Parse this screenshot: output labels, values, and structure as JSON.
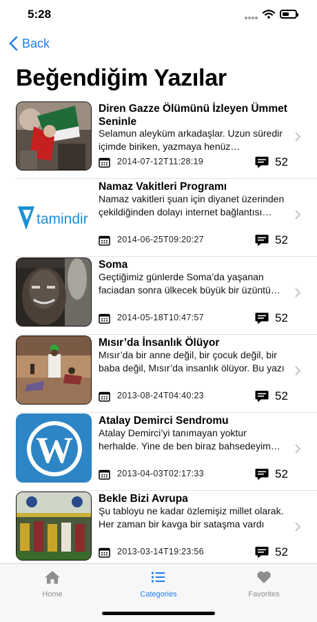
{
  "status": {
    "time": "5:28"
  },
  "nav": {
    "back_label": "Back",
    "title": "Beğendiğim Yazılar"
  },
  "items": [
    {
      "title": "Diren Gazze Ölümünü İzleyen Ümmet Seninle",
      "desc": "Selamun aleyküm arkadaşlar. Uzun süredir içimde biriken, yazmaya henüz başlayamadığım",
      "date": "2014-07-12T11:28:19",
      "count": "52"
    },
    {
      "title": "Namaz Vakitleri Programı",
      "desc": "Namaz vakitleri şuan için diyanet üzerinden çekildiğinden dolayı internet bağlantısı gerekli",
      "date": "2014-06-25T09:20:27",
      "count": "52",
      "logo_text": "tamindir"
    },
    {
      "title": "Soma",
      "desc": "Geçtiğimiz günlerde Soma’da yaşanan faciadan sonra ülkecek büyük bir üzüntü yaşadık",
      "date": "2014-05-18T10:47:57",
      "count": "52"
    },
    {
      "title": "Mısır’da İnsanlık Ölüyor",
      "desc": "Mısır’da bir anne değil, bir çocuk değil, bir baba değil, Mısır’da insanlık ölüyor. Bu yazı",
      "date": "2013-08-24T04:40:23",
      "count": "52"
    },
    {
      "title": "Atalay Demirci Sendromu",
      "desc": "Atalay Demirci’yi tanımayan yoktur herhalde. Yine de ben biraz bahsedeyim kendisinden",
      "date": "2013-04-03T02:17:33",
      "count": "52"
    },
    {
      "title": "Bekle Bizi Avrupa",
      "desc": "Şu tabloyu ne kadar özlemişiz millet olarak. Her zaman bir kavga bir sataşma vardı",
      "date": "2013-03-14T19:23:56",
      "count": "52"
    }
  ],
  "tabs": [
    {
      "label": "Home",
      "icon": "home-icon"
    },
    {
      "label": "Categories",
      "icon": "list-icon",
      "active": true
    },
    {
      "label": "Favorites",
      "icon": "heart-icon"
    }
  ],
  "colors": {
    "accent": "#1e7cf2",
    "inactive": "#8e8e8e"
  }
}
